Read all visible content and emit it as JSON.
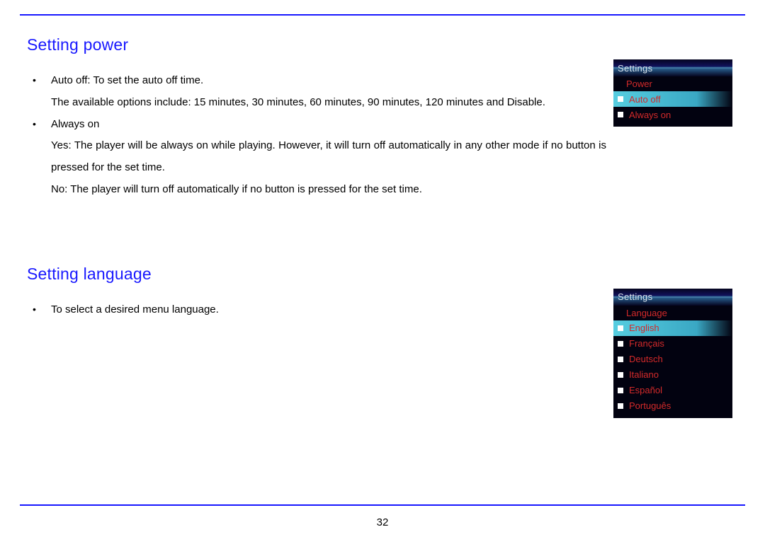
{
  "page_number": "32",
  "sections": {
    "power": {
      "heading": "Setting power",
      "bullets": [
        {
          "lead": "Auto off: To set the auto off time.",
          "extra": "The available options include: 15 minutes, 30 minutes, 60 minutes, 90 minutes, 120 minutes and Disable."
        },
        {
          "lead": "Always on",
          "extra": "Yes: The player will be always on while playing. However, it will turn off automatically in any other mode if no button is pressed for the set time."
        }
      ],
      "sub_line": "No: The player will turn off automatically if no button is pressed for the set time.",
      "device": {
        "title": "Settings",
        "subtitle": "Power",
        "items": [
          {
            "label": "Auto off",
            "selected": true
          },
          {
            "label": "Always on",
            "selected": false
          }
        ]
      }
    },
    "language": {
      "heading": "Setting language",
      "bullets": [
        {
          "lead": "To select a desired menu language."
        }
      ],
      "device": {
        "title": "Settings",
        "subtitle": "Language",
        "items": [
          {
            "label": "English",
            "selected": true
          },
          {
            "label": "Français",
            "selected": false
          },
          {
            "label": "Deutsch",
            "selected": false
          },
          {
            "label": "Italiano",
            "selected": false
          },
          {
            "label": "Español",
            "selected": false
          },
          {
            "label": "Português",
            "selected": false
          }
        ]
      }
    }
  }
}
